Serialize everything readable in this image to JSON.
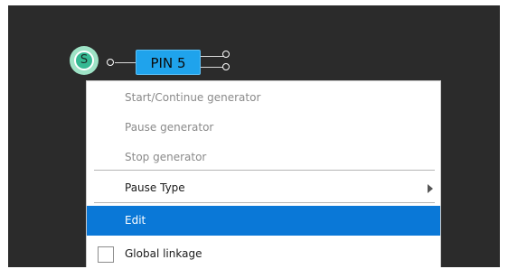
{
  "node": {
    "generator_letter": "S",
    "pin_label": "PIN 5"
  },
  "menu": {
    "items": [
      {
        "label": "Start/Continue generator",
        "enabled": false
      },
      {
        "label": "Pause generator",
        "enabled": false
      },
      {
        "label": "Stop generator",
        "enabled": false
      },
      {
        "label": "Pause Type",
        "enabled": true,
        "submenu": true
      },
      {
        "label": "Edit",
        "enabled": true,
        "selected": true
      },
      {
        "label": "Global linkage",
        "enabled": true,
        "checkbox": true,
        "checked": false
      }
    ]
  },
  "colors": {
    "canvas_bg": "#2b2b2b",
    "pin_block": "#1fa3ec",
    "generator_node": "#35b993",
    "selection": "#0a78d7"
  }
}
